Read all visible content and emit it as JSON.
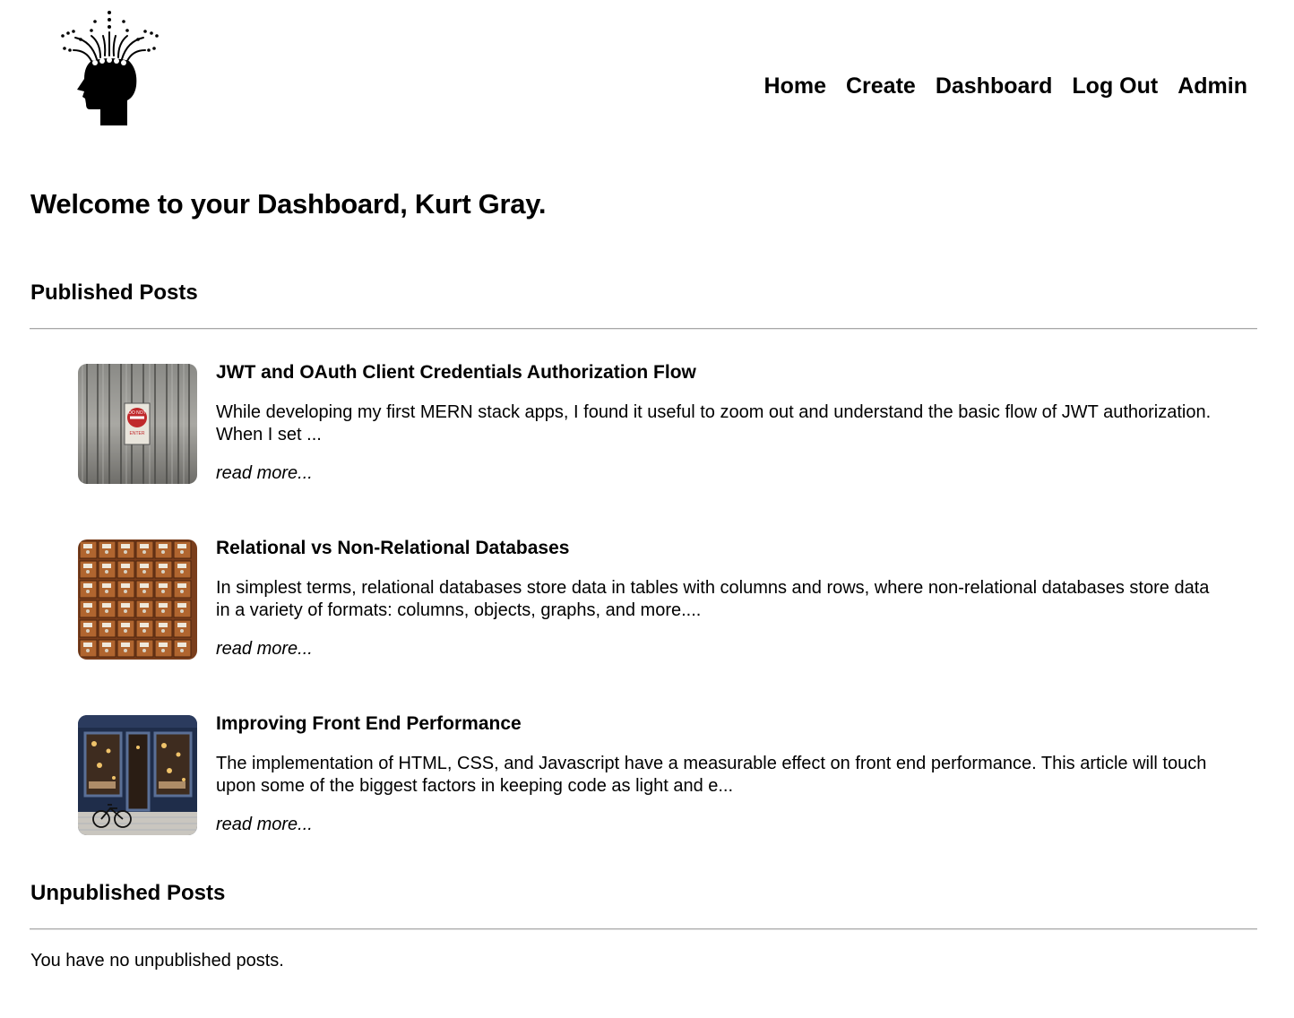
{
  "nav": {
    "items": [
      {
        "label": "Home"
      },
      {
        "label": "Create"
      },
      {
        "label": "Dashboard"
      },
      {
        "label": "Log Out"
      },
      {
        "label": "Admin"
      }
    ]
  },
  "logo": {
    "icon": "head-with-rays-logo"
  },
  "welcome": "Welcome to your Dashboard, Kurt Gray.",
  "published": {
    "title": "Published Posts",
    "posts": [
      {
        "title": "JWT and OAuth Client Credentials Authorization Flow",
        "excerpt": "While developing my first MERN stack apps, I found it useful to zoom out and understand the basic flow of JWT authorization. When I set ...",
        "read_more": "read more...",
        "thumb_icon": "do-not-enter-sign-thumbnail",
        "sign_line1": "DO NOT",
        "sign_line2": "ENTER"
      },
      {
        "title": "Relational vs Non-Relational Databases",
        "excerpt": "In simplest terms, relational databases store data in tables with columns and rows, where non-relational databases store data in a variety of formats: columns, objects, graphs, and more....",
        "read_more": "read more...",
        "thumb_icon": "card-catalog-drawers-thumbnail"
      },
      {
        "title": "Improving Front End Performance",
        "excerpt": "The implementation of HTML, CSS, and Javascript have a measurable effect on front end performance. This article will touch upon some of the biggest factors in keeping code as light and e...",
        "read_more": "read more...",
        "thumb_icon": "storefront-bicycle-thumbnail"
      }
    ]
  },
  "unpublished": {
    "title": "Unpublished Posts",
    "empty_message": "You have no unpublished posts."
  },
  "colors": {
    "text": "#000000",
    "background": "#ffffff",
    "divider": "#a8a8a8"
  }
}
